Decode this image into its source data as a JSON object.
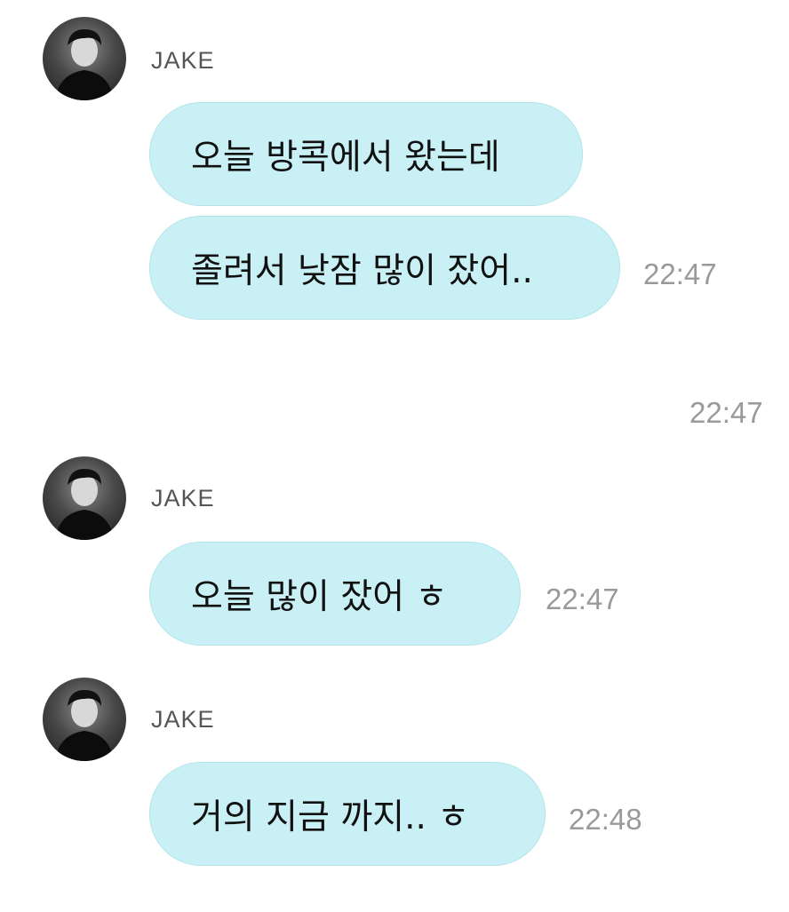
{
  "messages": [
    {
      "sender": "JAKE",
      "bubbles": [
        "오늘 방콕에서 왔는데",
        "졸려서 낮잠 많이 잤어.."
      ],
      "time": "22:47"
    },
    {
      "standalone_time": "22:47"
    },
    {
      "sender": "JAKE",
      "bubbles": [
        "오늘 많이 잤어 ㅎ"
      ],
      "time": "22:47"
    },
    {
      "sender": "JAKE",
      "bubbles": [
        "거의 지금 까지.. ㅎ"
      ],
      "time": "22:48"
    }
  ],
  "colors": {
    "bubble_bg": "#c9f1f5",
    "time_text": "#9a9a9a",
    "name_text": "#555555"
  },
  "icons": {
    "avatar": "profile-photo"
  }
}
